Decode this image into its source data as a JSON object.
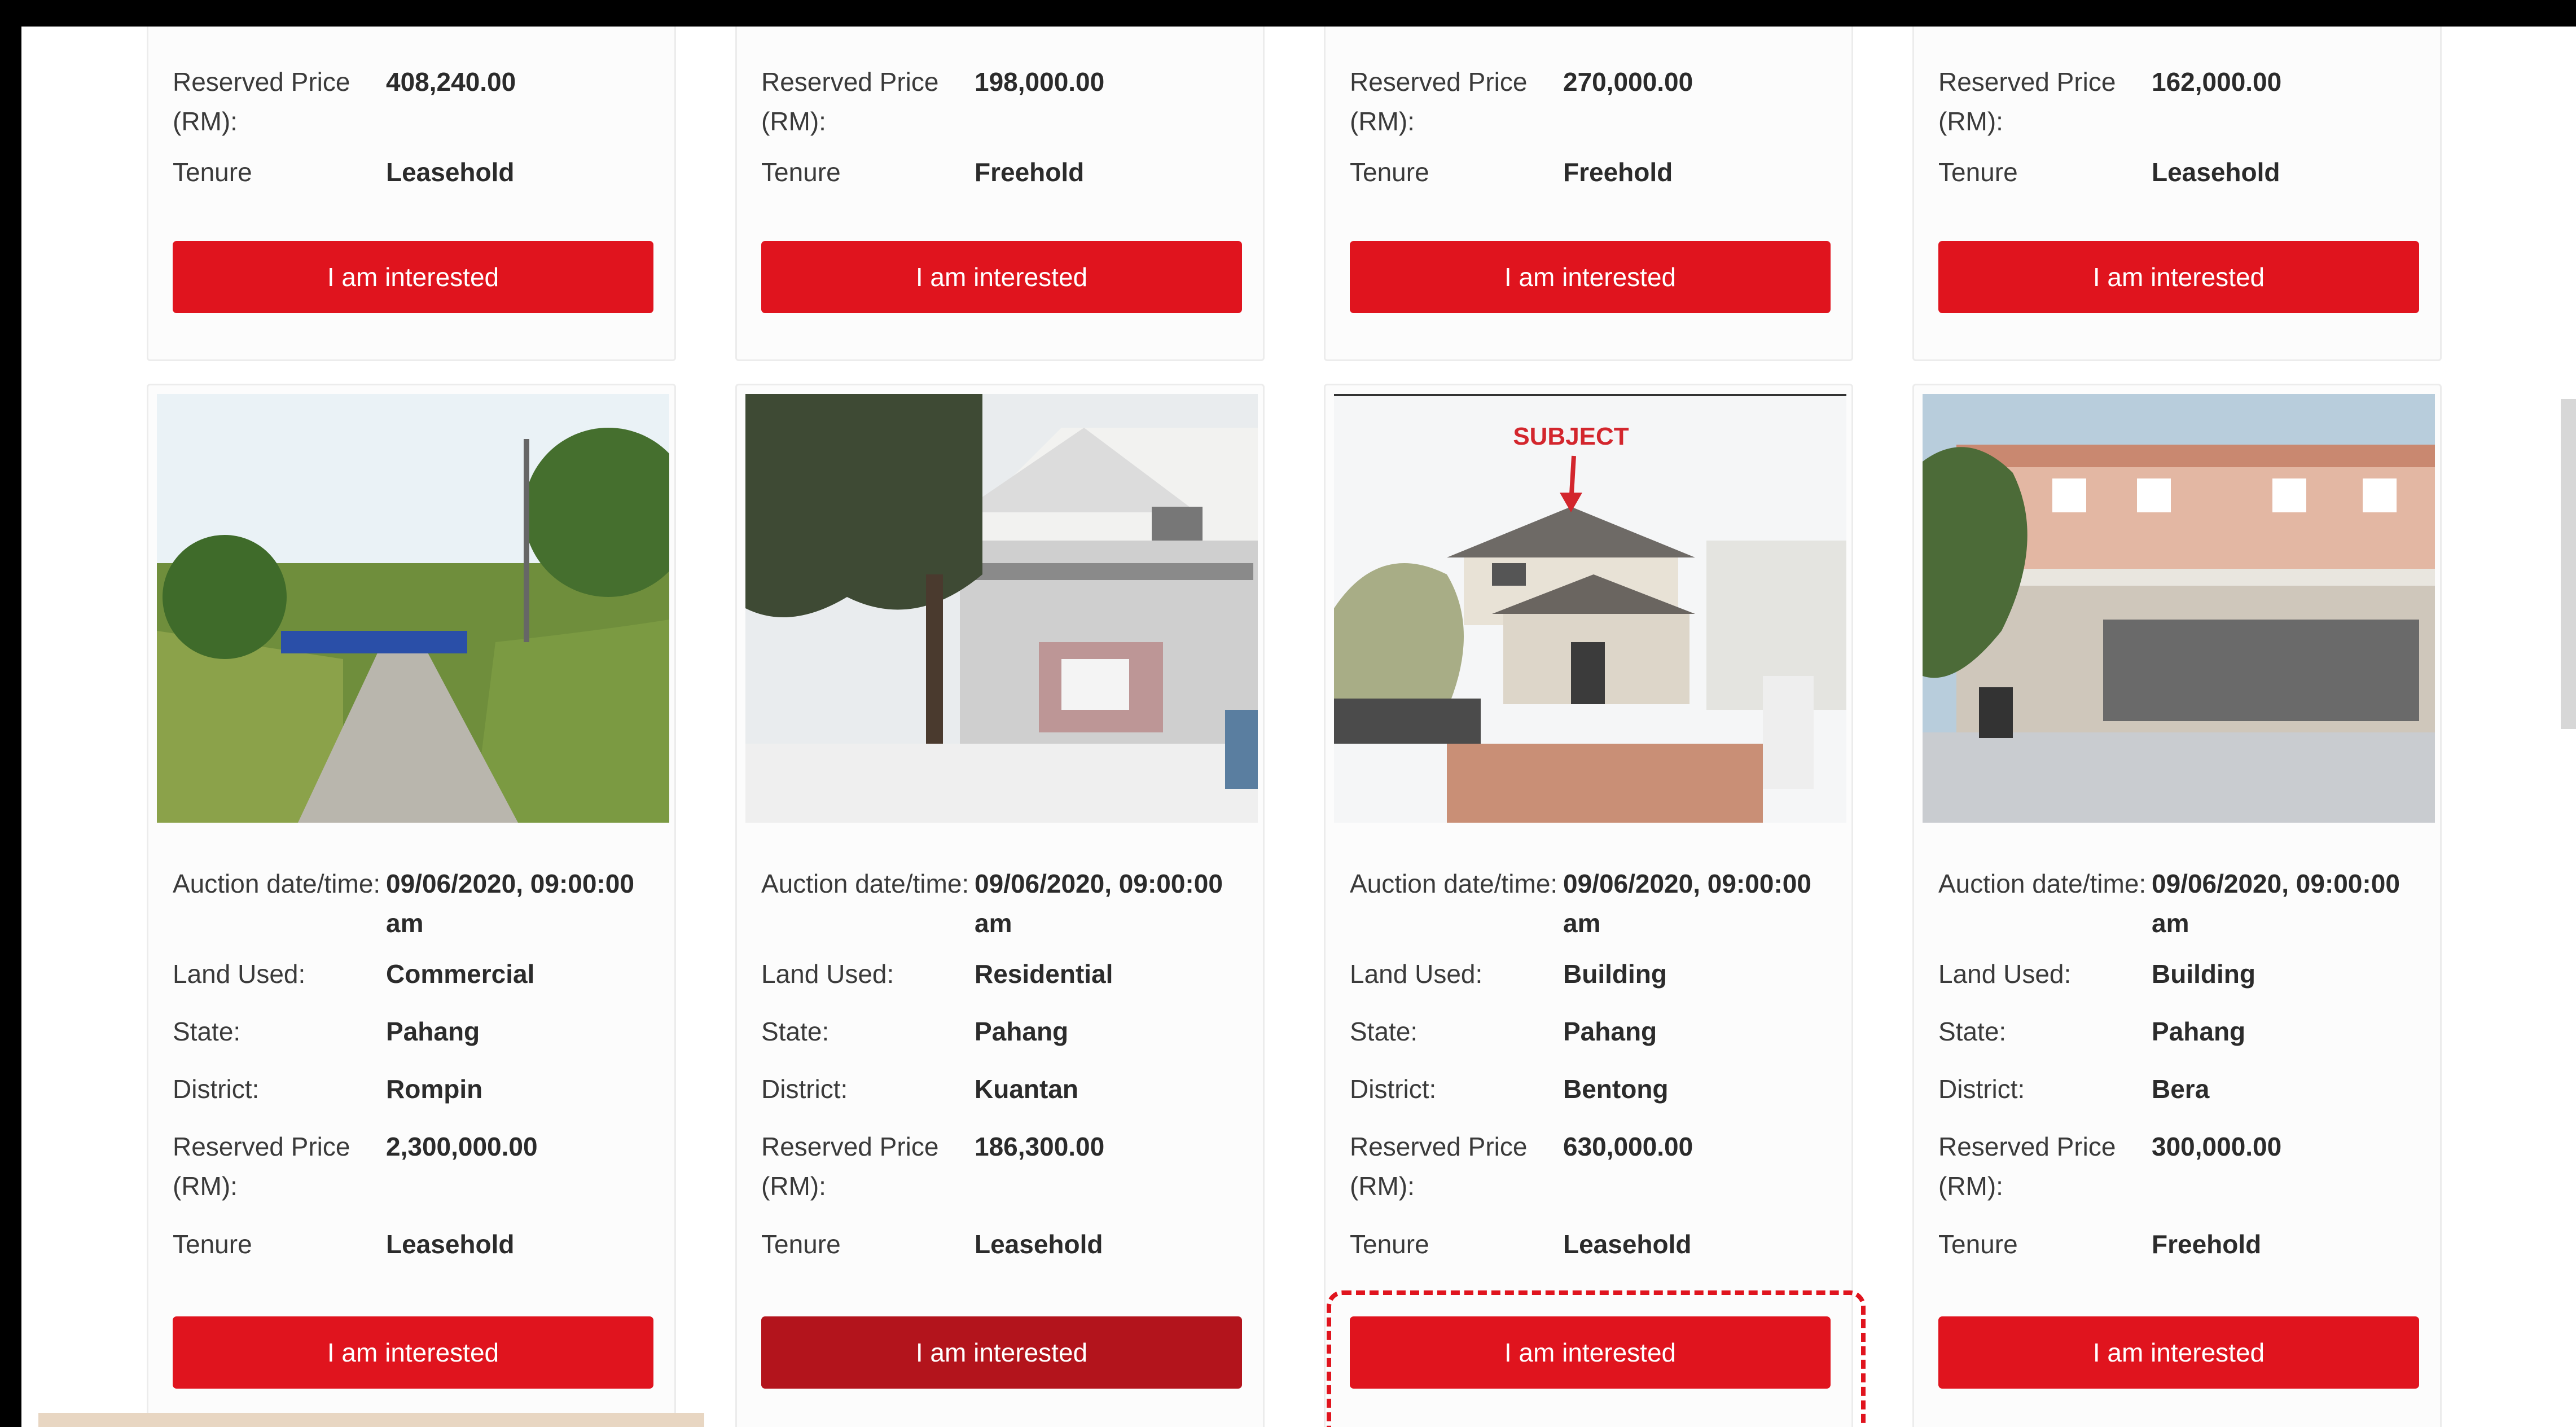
{
  "top_cards": [
    {
      "reserved_price_label": "Reserved Price (RM):",
      "reserved_price": "408,240.00",
      "tenure_label": "Tenure",
      "tenure": "Leasehold",
      "button": "I am interested"
    },
    {
      "reserved_price_label": "Reserved Price (RM):",
      "reserved_price": "198,000.00",
      "tenure_label": "Tenure",
      "tenure": "Freehold",
      "button": "I am interested"
    },
    {
      "reserved_price_label": "Reserved Price (RM):",
      "reserved_price": "270,000.00",
      "tenure_label": "Tenure",
      "tenure": "Freehold",
      "button": "I am interested"
    },
    {
      "reserved_price_label": "Reserved Price (RM):",
      "reserved_price": "162,000.00",
      "tenure_label": "Tenure",
      "tenure": "Leasehold",
      "button": "I am interested"
    }
  ],
  "bottom_cards": [
    {
      "auction_label": "Auction date/time:",
      "auction": "09/06/2020, 09:00:00 am",
      "land_label": "Land Used:",
      "land": "Commercial",
      "state_label": "State:",
      "state": "Pahang",
      "district_label": "District:",
      "district": "Rompin",
      "reserved_price_label": "Reserved Price (RM):",
      "reserved_price": "2,300,000.00",
      "tenure_label": "Tenure",
      "tenure": "Leasehold",
      "button": "I am interested"
    },
    {
      "auction_label": "Auction date/time:",
      "auction": "09/06/2020, 09:00:00 am",
      "land_label": "Land Used:",
      "land": "Residential",
      "state_label": "State:",
      "state": "Pahang",
      "district_label": "District:",
      "district": "Kuantan",
      "reserved_price_label": "Reserved Price (RM):",
      "reserved_price": "186,300.00",
      "tenure_label": "Tenure",
      "tenure": "Leasehold",
      "button": "I am interested"
    },
    {
      "photo_label": "SUBJECT",
      "auction_label": "Auction date/time:",
      "auction": "09/06/2020, 09:00:00 am",
      "land_label": "Land Used:",
      "land": "Building",
      "state_label": "State:",
      "state": "Pahang",
      "district_label": "District:",
      "district": "Bentong",
      "reserved_price_label": "Reserved Price (RM):",
      "reserved_price": "630,000.00",
      "tenure_label": "Tenure",
      "tenure": "Leasehold",
      "button": "I am interested"
    },
    {
      "auction_label": "Auction date/time:",
      "auction": "09/06/2020, 09:00:00 am",
      "land_label": "Land Used:",
      "land": "Building",
      "state_label": "State:",
      "state": "Pahang",
      "district_label": "District:",
      "district": "Bera",
      "reserved_price_label": "Reserved Price (RM):",
      "reserved_price": "300,000.00",
      "tenure_label": "Tenure",
      "tenure": "Freehold",
      "button": "I am interested"
    }
  ],
  "colors": {
    "button_red": "#e0141e",
    "button_hover": "#b3141c",
    "highlight_dash": "#e0141e"
  }
}
